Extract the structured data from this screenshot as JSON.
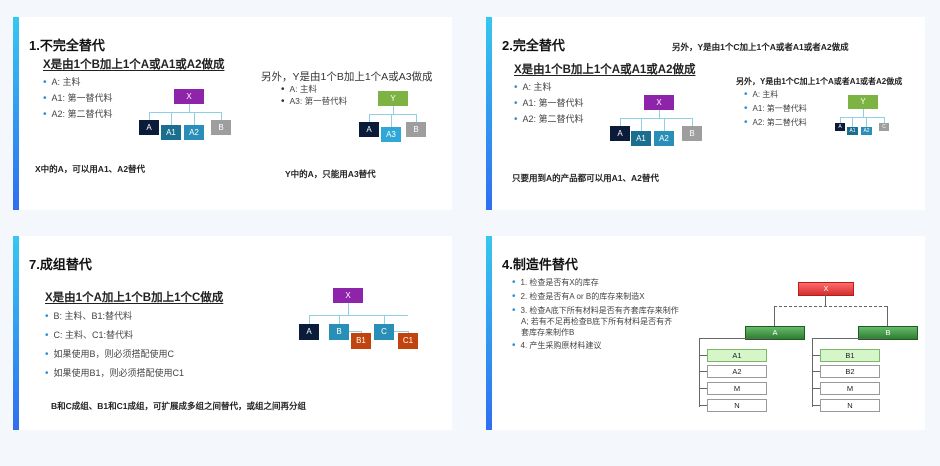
{
  "card1": {
    "title": "1.不完全替代",
    "subtitle": "X是由1个B加上1个A或A1或A2做成",
    "bullets": [
      "A: 主料",
      "A1: 第一替代料",
      "A2: 第二替代料"
    ],
    "other_title": "另外，Y是由1个B加上1个A或A3做成",
    "other_bullets": [
      "A: 主料",
      "A3: 第一替代料"
    ],
    "note1": "X中的A，可以用A1、A2替代",
    "note2": "Y中的A，只能用A3替代",
    "tree1": {
      "root": "X",
      "children": [
        "A",
        "A1",
        "A2",
        "B"
      ]
    },
    "tree2": {
      "root": "Y",
      "children": [
        "A",
        "A3",
        "B"
      ]
    }
  },
  "card2": {
    "title": "2.完全替代",
    "header_right": "另外，Y是由1个C加上1个A或者A1或者A2做成",
    "subtitle": "X是由1个B加上1个A或A1或A2做成",
    "bullets": [
      "A: 主料",
      "A1: 第一替代料",
      "A2: 第二替代料"
    ],
    "other_title": "另外，Y是由1个C加上1个A或者A1或者A2做成",
    "other_bullets": [
      "A: 主料",
      "A1: 第一替代料",
      "A2: 第二替代料"
    ],
    "note": "只要用到A的产品都可以用A1、A2替代",
    "tree1": {
      "root": "X",
      "children": [
        "A",
        "A1",
        "A2",
        "B"
      ]
    },
    "tree2": {
      "root": "Y",
      "children": [
        "A",
        "A1",
        "A2",
        "C"
      ]
    }
  },
  "card3": {
    "title": "7.成组替代",
    "subtitle": "X是由1个A加上1个B加上1个C做成",
    "bullets": [
      "B: 主料、B1:替代料",
      "C: 主料、C1:替代料",
      "如果使用B，则必须搭配使用C",
      "如果使用B1，则必须搭配使用C1"
    ],
    "note": "B和C成组、B1和C1成组，可扩展成多组之间替代，或组之间再分组",
    "tree": {
      "root": "X",
      "children": [
        "A",
        "B",
        "B1",
        "C",
        "C1"
      ]
    }
  },
  "card4": {
    "title": "4.制造件替代",
    "bullets": [
      "1. 检查是否有X的库存",
      "2. 检查是否有A or B的库存来制造X",
      "3. 检查A底下所有材料是否有齐套库存来制作A; 若有不足再检查B底下所有材料是否有齐套库存来制作B",
      "4. 产生采购原材料建议"
    ],
    "bullet3_line1": "3. 检查A底下所有材料是否有齐套库存来制作",
    "bullet3_line2": "A; 若有不足再检查B底下所有材料是否有齐",
    "bullet3_line3": "套库存来制作B",
    "tree": {
      "root": "X",
      "mid": [
        "A",
        "B"
      ],
      "left": [
        "A1",
        "A2",
        "M",
        "N"
      ],
      "right": [
        "B1",
        "B2",
        "M",
        "N"
      ]
    }
  },
  "colors": {
    "accent": "#2f6ef0",
    "purple": "#8e24aa",
    "green": "#7cb342",
    "navy": "#0b1b3a",
    "teal": "#1a6e8e",
    "gray": "#9e9e9e",
    "orange": "#c1440e",
    "red": "#e53935"
  }
}
